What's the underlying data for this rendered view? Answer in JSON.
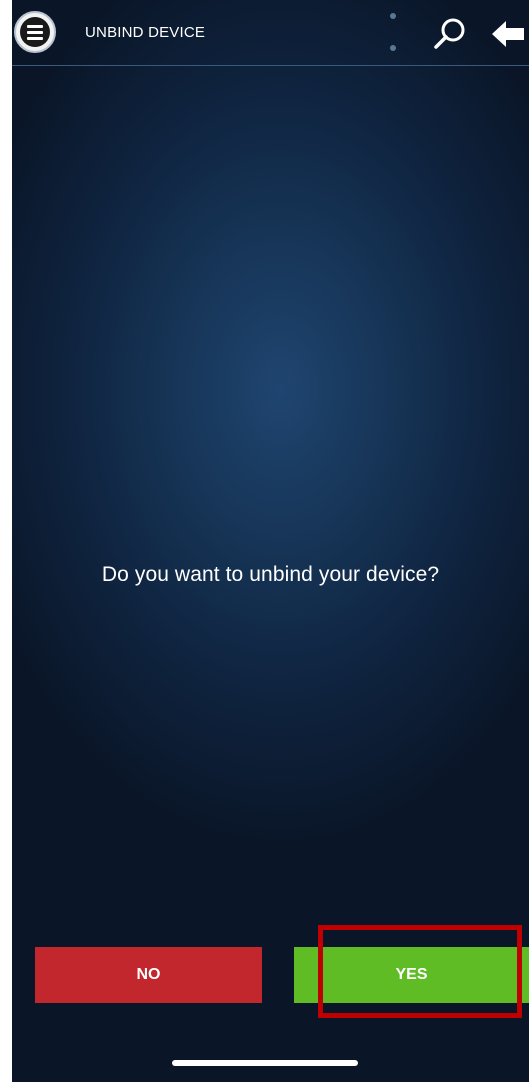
{
  "header": {
    "title": "UNBIND DEVICE",
    "menu_icon": "hamburger-menu-icon",
    "search_icon": "search-icon",
    "back_icon": "back-arrow-icon"
  },
  "dialog": {
    "prompt": "Do you want to unbind your device?"
  },
  "actions": {
    "no_label": "NO",
    "yes_label": "YES"
  },
  "colors": {
    "background_center": "#1f4570",
    "background_edge": "#0a1628",
    "no_button": "#c1272d",
    "yes_button": "#5fbc25",
    "highlight": "#c00000"
  }
}
